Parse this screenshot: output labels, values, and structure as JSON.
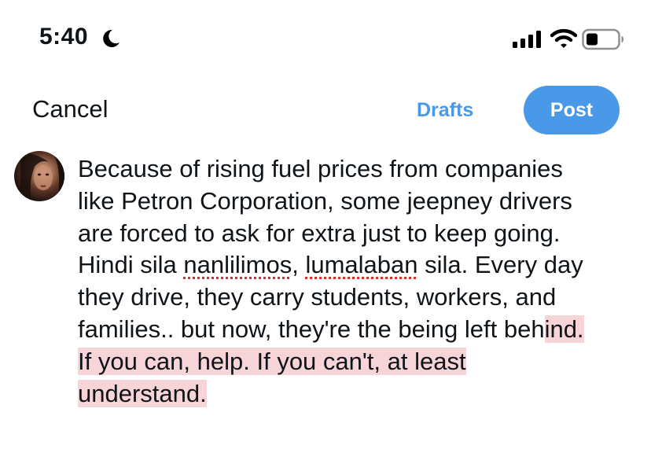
{
  "status_bar": {
    "time": "5:40",
    "icons": [
      "moon-icon",
      "cellular-signal-icon",
      "wifi-icon",
      "battery-icon"
    ]
  },
  "header": {
    "cancel_label": "Cancel",
    "drafts_label": "Drafts",
    "post_label": "Post"
  },
  "colors": {
    "accent": "#4a99e9",
    "text": "#0f1419",
    "highlight": "#f7d4d8",
    "spellcheck": "#d0342c"
  },
  "compose": {
    "line1": "Because of rising fuel prices from companies",
    "line2": "like Petron Corporation, some jeepney drivers",
    "line3": "are forced to ask for extra just to keep going.",
    "line4": {
      "a": "Hindi sila ",
      "word1": "nanlilimos",
      "b": ", ",
      "word2": "lumalaban",
      "c": " sila. Every day"
    },
    "line5": "they drive, they carry students, workers, and",
    "line6": {
      "a": "families.. but now, they're the being left beh",
      "b": "ind."
    },
    "line7": "If you can, help. If you can't, at least",
    "line8": "understand."
  }
}
